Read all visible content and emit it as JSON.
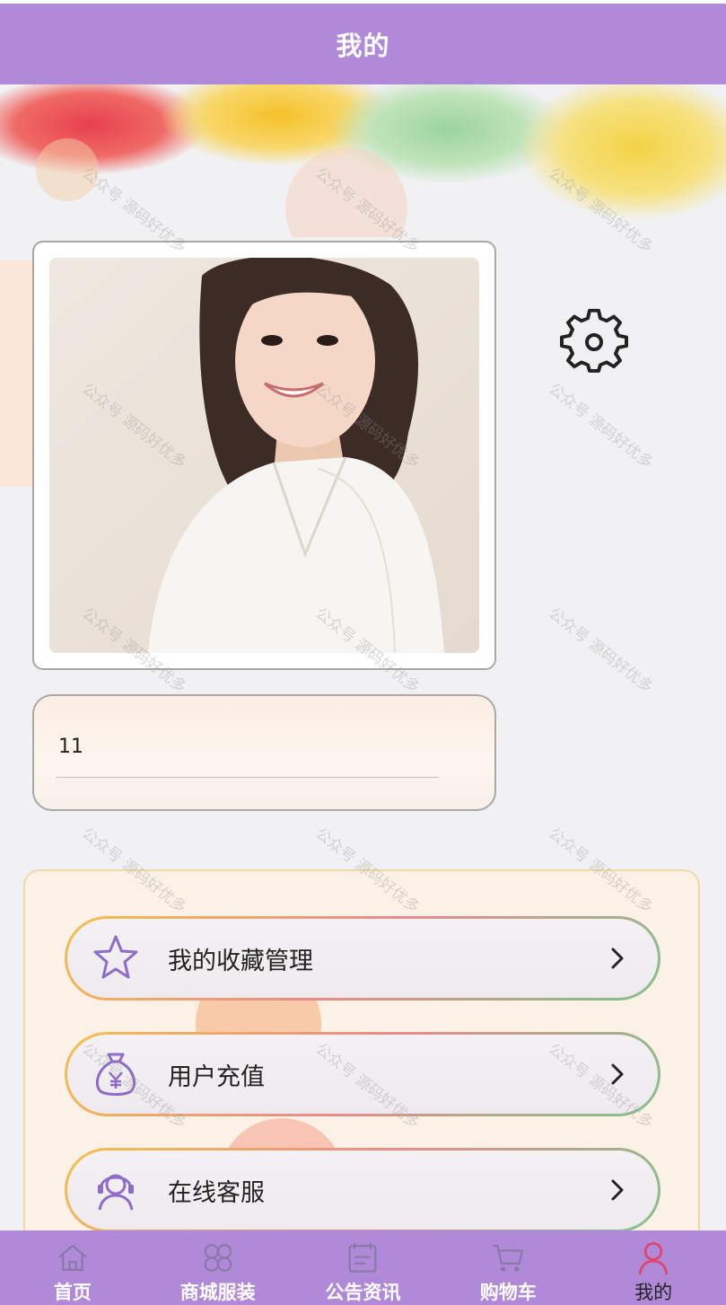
{
  "header": {
    "title": "我的"
  },
  "profile": {
    "username": "11",
    "settings_icon": "gear-icon"
  },
  "menu": [
    {
      "label": "我的收藏管理",
      "icon": "star-icon"
    },
    {
      "label": "用户充值",
      "icon": "money-bag-icon"
    },
    {
      "label": "在线客服",
      "icon": "headset-icon"
    }
  ],
  "tabbar": [
    {
      "label": "首页",
      "icon": "home-icon",
      "active": false
    },
    {
      "label": "商城服装",
      "icon": "grid-icon",
      "active": false
    },
    {
      "label": "公告资讯",
      "icon": "news-icon",
      "active": false
    },
    {
      "label": "购物车",
      "icon": "cart-icon",
      "active": false
    },
    {
      "label": "我的",
      "icon": "user-icon",
      "active": true
    }
  ],
  "watermark": "公众号 源码好优多",
  "colors": {
    "header_bg": "#b08ad8",
    "tabbar_bg": "#b08ad8",
    "active_icon": "#e0456b",
    "menu_icon": "#8e6cc9"
  }
}
